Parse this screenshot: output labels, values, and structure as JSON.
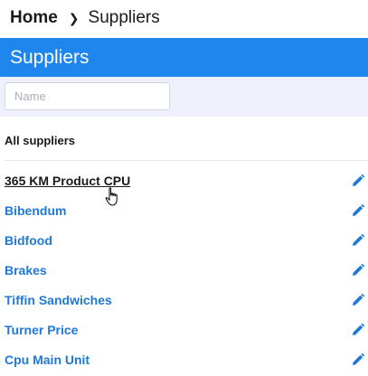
{
  "breadcrumb": {
    "home": "Home",
    "current": "Suppliers"
  },
  "header": {
    "title": "Suppliers"
  },
  "filter": {
    "name_placeholder": "Name",
    "name_value": ""
  },
  "list": {
    "section_title": "All suppliers",
    "suppliers": [
      "365 KM Product CPU",
      "Bibendum",
      "Bidfood",
      "Brakes",
      "Tiffin Sandwiches",
      "Turner Price",
      "Cpu Main Unit"
    ],
    "edit_icon": "pencil-icon"
  },
  "colors": {
    "header_bg": "#1f86ee",
    "link": "#1f78d8",
    "filter_bg": "#eef1fb"
  }
}
